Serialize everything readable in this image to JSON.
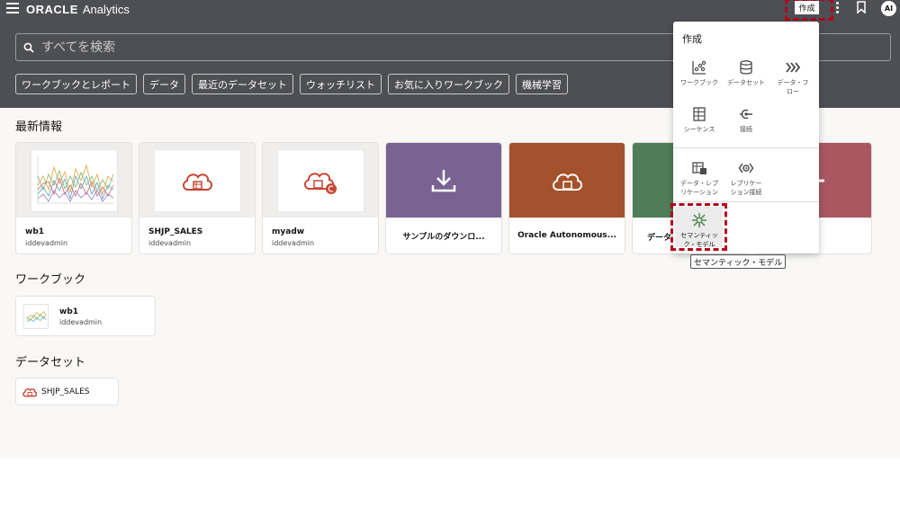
{
  "header": {
    "brand": "ORACLE",
    "app_name": "Analytics",
    "create_button": "作成",
    "avatar_initials": "AI"
  },
  "search": {
    "placeholder": "すべてを検索"
  },
  "filters": [
    "ワークブックとレポート",
    "データ",
    "最近のデータセット",
    "ウォッチリスト",
    "お気に入りワークブック",
    "機械学習"
  ],
  "recent": {
    "title": "最新情報",
    "cards": [
      {
        "name": "wb1",
        "owner": "iddevadmin"
      },
      {
        "name": "SHJP_SALES",
        "owner": "iddevadmin"
      },
      {
        "name": "myadw",
        "owner": "iddevadmin"
      },
      {
        "title": "サンプルのダウンロ...",
        "color": "#7a6293"
      },
      {
        "title": "Oracle Autonomous...",
        "color": "#a4522b"
      },
      {
        "title": "データ",
        "color": "#4f7d57"
      }
    ]
  },
  "workbooks": {
    "title": "ワークブック",
    "items": [
      {
        "name": "wb1",
        "owner": "iddevadmin"
      }
    ]
  },
  "datasets": {
    "title": "データセット",
    "items": [
      {
        "name": "SHJP_SALES"
      }
    ]
  },
  "create_menu": {
    "title": "作成",
    "items": [
      {
        "label": "ワークブック",
        "icon": "workbook-icon"
      },
      {
        "label": "データセット",
        "icon": "dataset-icon"
      },
      {
        "label": "データ・フ\nロー",
        "icon": "dataflow-icon"
      },
      {
        "label": "シーケンス",
        "icon": "sequence-icon"
      },
      {
        "label": "接続",
        "icon": "connection-icon"
      },
      {
        "label": "データ・レプ\nリケーション",
        "icon": "data-replication-icon"
      },
      {
        "label": "レプリケー\nション接続",
        "icon": "replication-connection-icon"
      },
      {
        "label": "セマンティッ\nク・モデル",
        "icon": "semantic-model-icon"
      }
    ],
    "tooltip": "セマンティック・モデル"
  },
  "colors": {
    "header_bg": "#4e4f54",
    "main_bg": "#f9f8f6",
    "highlight": "#b3001b",
    "brand_red": "#c74634",
    "semantic_green": "#5b8c5a"
  }
}
